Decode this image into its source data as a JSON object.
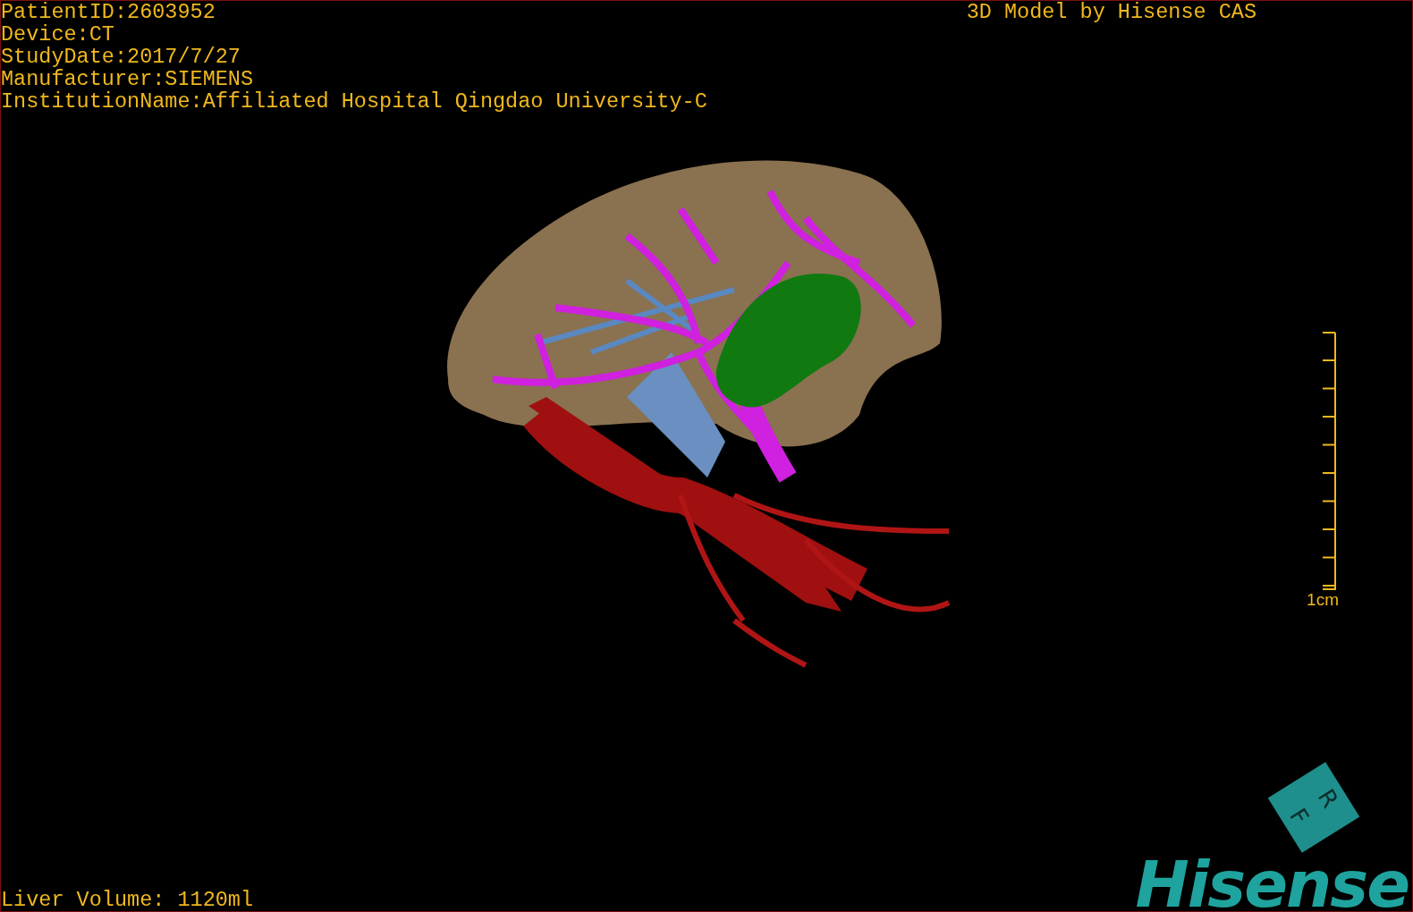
{
  "info_lines": [
    "PatientID:2603952",
    "Device:CT",
    "StudyDate:2017/7/27",
    "Manufacturer:SIEMENS",
    "InstitutionName:Affiliated Hospital Qingdao University-C"
  ],
  "title": "3D Model by Hisense CAS",
  "scale_bar": {
    "label": "1cm"
  },
  "liver_volume": "Liver Volume: 1120ml",
  "orientation_cube": {
    "faces": [
      "R",
      "F"
    ]
  },
  "logo": "Hisense"
}
